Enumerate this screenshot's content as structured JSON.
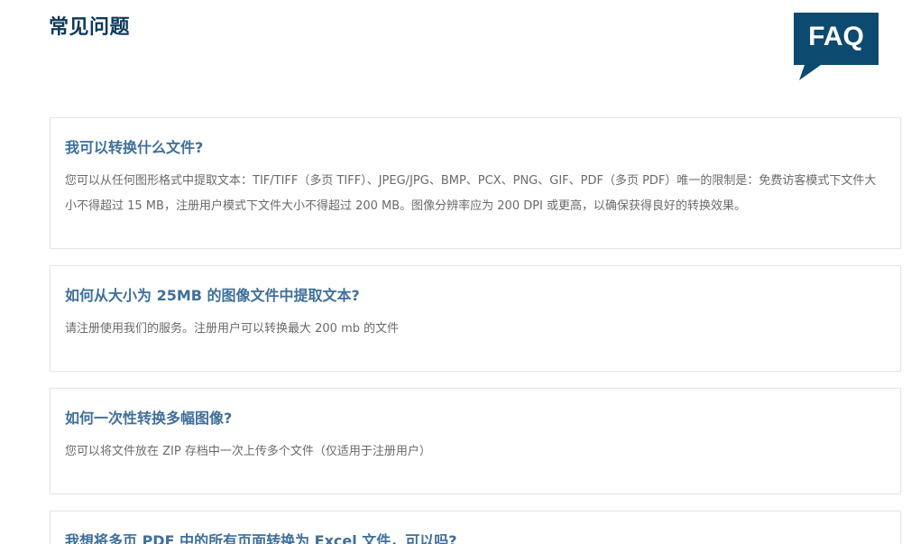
{
  "page": {
    "title": "常见问题"
  },
  "logo": {
    "text": "FAQ",
    "color": "#0d4a70",
    "icon": "speech-bubble-icon"
  },
  "faqs": [
    {
      "question": "我可以转换什么文件?",
      "answer": "您可以从任何图形格式中提取文本：TIF/TIFF（多页 TIFF）、JPEG/JPG、BMP、PCX、PNG、GIF、PDF（多页 PDF）唯一的限制是：免费访客模式下文件大小不得超过 15 MB，注册用户模式下文件大小不得超过 200 MB。图像分辨率应为 200 DPI 或更高，以确保获得良好的转换效果。"
    },
    {
      "question": "如何从大小为 25MB 的图像文件中提取文本?",
      "answer": "请注册使用我们的服务。注册用户可以转换最大 200 mb 的文件"
    },
    {
      "question": "如何一次性转换多幅图像?",
      "answer": "您可以将文件放在 ZIP 存档中一次上传多个文件（仅适用于注册用户）"
    },
    {
      "question": "我想将多页 PDF 中的所有页面转换为 Excel 文件，可以吗?",
      "answer": ""
    }
  ],
  "colors": {
    "title": "#0d3a5c",
    "question": "#3f6f9a",
    "answer": "#6a6a6a",
    "card_border": "#e6e6e6"
  }
}
